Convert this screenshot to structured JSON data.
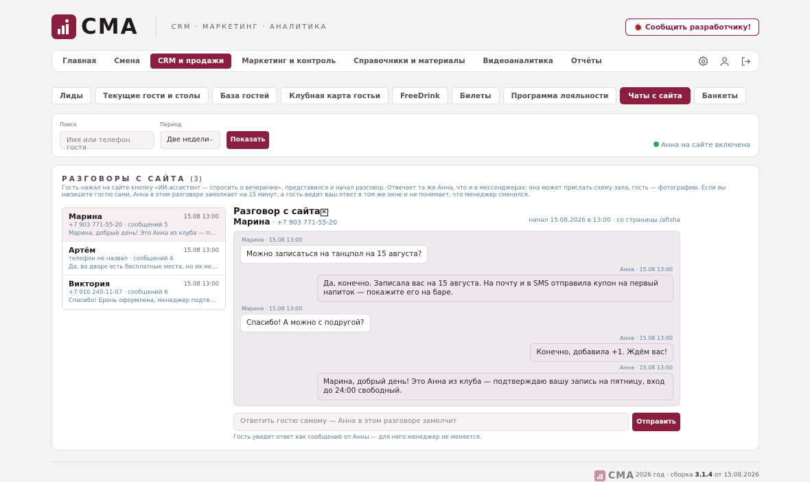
{
  "header": {
    "logo_text": "CMA",
    "nav": [
      "CRM",
      "МАРКЕТИНГ",
      "АНАЛИТИКА"
    ],
    "report_label": "🐞 Сообщить разработчику!"
  },
  "main_nav": {
    "tabs": [
      "Главная",
      "Смена",
      "CRM и продажи",
      "Маркетинг и контроль",
      "Справочники и материалы",
      "Видеоаналитика",
      "Отчёты"
    ],
    "active": "CRM и продажи",
    "icons": [
      "settings-icon",
      "user-icon",
      "logout-icon"
    ]
  },
  "sub_tabs": {
    "tabs": [
      "Лиды",
      "Текущие гости и столы",
      "База гостей",
      "Клубная карта гостьи",
      "FreeDrink",
      "Билеты",
      "Программа лояльности",
      "Чаты с сайта",
      "Банкеты"
    ],
    "active": "Чаты с сайта"
  },
  "filter": {
    "search_label": "Поиск",
    "search_placeholder": "Имя или телефон гостя",
    "period_label": "Период",
    "period_value": "Две недели",
    "show_button": "Показать",
    "status_text": "Анна на сайте включена"
  },
  "panel": {
    "title": "РАЗГОВОРЫ С САЙТА",
    "count": "(3)",
    "description": "Гость нажал на сайте кнопку «ИИ-ассистент — спросить о вечеринке», представился и начал разговор. Отвечает та же Анна, что и в мессенджерах: она может прислать схему зала, гость — фотографию. Если вы напишете гостю сами, Анна в этом разговоре замолкает на 15 минут, а гость видит ваш ответ в том же окне и не понимает, что менеджер сменился."
  },
  "conversations": [
    {
      "name": "Марина",
      "time": "15.08 13:00",
      "meta": "+7 903 771-55-20 · сообщений 5",
      "preview": "Марина, добрый день! Это Анна из клуба — подтверждаю вашу запись"
    },
    {
      "name": "Артём",
      "time": "15.08 13:00",
      "meta": "телефон не назвал · сообщений 4",
      "preview": "Да, во дворе есть бесплатные места, но их немного"
    },
    {
      "name": "Виктория",
      "time": "15.08 13:00",
      "meta": "+7 916 240-11-07 · сообщений 6",
      "preview": "Спасибо! Бронь оформлена, менеджер подтвердит"
    }
  ],
  "chat": {
    "title": "Разговор с сайта",
    "close_glyph": "×",
    "guest_name": "Марина",
    "guest_phone": "· +7 903 771-55-20",
    "started": "начал 15.08.2026 в 13:00 · со страницы /afisha",
    "messages": [
      {
        "meta": "Марина · 15.08 13:00",
        "text": "Можно записаться на танцпол на 15 августа?",
        "dir": "in"
      },
      {
        "meta": "Анна · 15.08 13:00",
        "text": "Да, конечно. Записала вас на 15 августа. На почту и в SMS отправила купон на первый напиток — покажите его на баре.",
        "dir": "out"
      },
      {
        "meta": "Марина · 15.08 13:00",
        "text": "Спасибо! А можно с подругой?",
        "dir": "in"
      },
      {
        "meta": "Анна · 15.08 13:00",
        "text": "Конечно, добавила +1. Ждём вас!",
        "dir": "out"
      },
      {
        "meta": "Анна · 15.08 13:00",
        "text": "Марина, добрый день! Это Анна из клуба — подтверждаю вашу запись на пятницу, вход до 24:00 свободный.",
        "dir": "out"
      }
    ],
    "reply_placeholder": "Ответить гостю самому — Анна в этом разговоре замолчит",
    "send_label": "Отправить",
    "hint": "Гость увидит ответ как сообщение от Анны — для него менеджер не меняется."
  },
  "footer": {
    "logo_text": "CMA",
    "build_prefix": "2026 год · сборка",
    "build_version": "3.1.4",
    "build_suffix": "от 15.08.2026"
  },
  "colors": {
    "accent": "#8b1d3f",
    "link": "#5b7ea1",
    "online": "#2fa84f"
  }
}
